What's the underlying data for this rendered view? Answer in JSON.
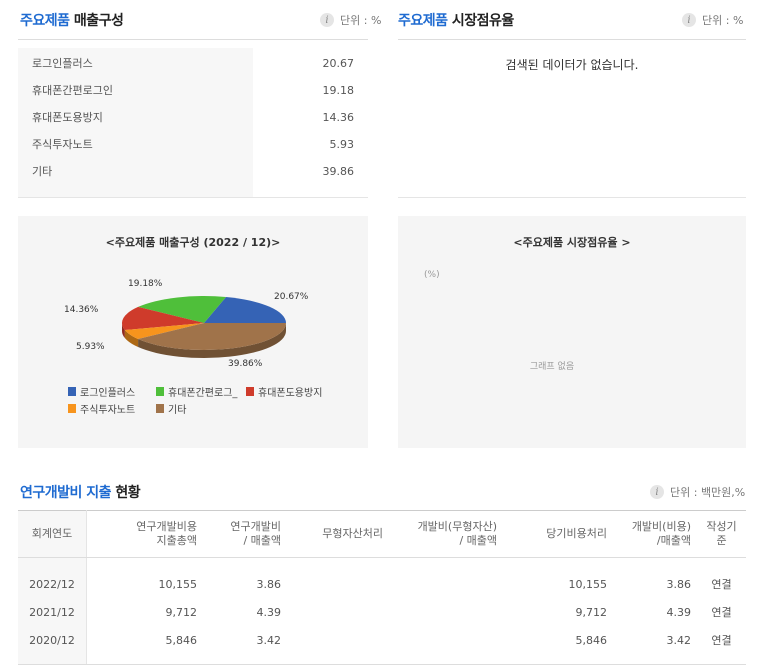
{
  "sales_section": {
    "title_blue": "주요제품",
    "title_rest": "매출구성",
    "unit": "단위 : %",
    "items": [
      {
        "name": "로그인플러스",
        "value": "20.67"
      },
      {
        "name": "휴대폰간편로그인",
        "value": "19.18"
      },
      {
        "name": "휴대폰도용방지",
        "value": "14.36"
      },
      {
        "name": "주식투자노트",
        "value": "5.93"
      },
      {
        "name": "기타",
        "value": "39.86"
      }
    ]
  },
  "share_section": {
    "title_blue": "주요제품",
    "title_rest": "시장점유율",
    "unit": "단위 : %",
    "empty_message": "검색된 데이터가 없습니다."
  },
  "pie_panel": {
    "title": "<주요제품 매출구성 (2022 / 12)>",
    "labels": [
      "20.67%",
      "19.18%",
      "14.36%",
      "5.93%",
      "39.86%"
    ],
    "legend": [
      "로그인플러스",
      "휴대폰간편로그_",
      "휴대폰도용방지",
      "주식투자노트",
      "기타"
    ]
  },
  "share_panel": {
    "title": "<주요제품 시장점유율 >",
    "unit_label": "(%)",
    "empty_text": "그래프 없음"
  },
  "chart_data": {
    "type": "pie",
    "title": "<주요제품 매출구성 (2022 / 12)>",
    "categories": [
      "로그인플러스",
      "휴대폰간편로그인",
      "휴대폰도용방지",
      "주식투자노트",
      "기타"
    ],
    "values": [
      20.67,
      19.18,
      14.36,
      5.93,
      39.86
    ],
    "colors": [
      "#3563b5",
      "#4fbf3a",
      "#cf3b2b",
      "#f7941d",
      "#a0734a"
    ],
    "legend_position": "bottom-left"
  },
  "rd_section": {
    "title_blue": "연구개발비 지출",
    "title_rest": "현황",
    "unit": "단위 : 백만원,%",
    "headers": [
      "회계연도",
      "연구개발비용\n지출총액",
      "연구개발비\n/ 매출액",
      "무형자산처리",
      "개발비(무형자산)\n/ 매출액",
      "당기비용처리",
      "개발비(비용)\n/매출액",
      "작성기준"
    ],
    "rows": [
      [
        "2022/12",
        "10,155",
        "3.86",
        "",
        "",
        "10,155",
        "3.86",
        "연결"
      ],
      [
        "2021/12",
        "9,712",
        "4.39",
        "",
        "",
        "9,712",
        "4.39",
        "연결"
      ],
      [
        "2020/12",
        "5,846",
        "3.42",
        "",
        "",
        "5,846",
        "3.42",
        "연결"
      ]
    ]
  }
}
